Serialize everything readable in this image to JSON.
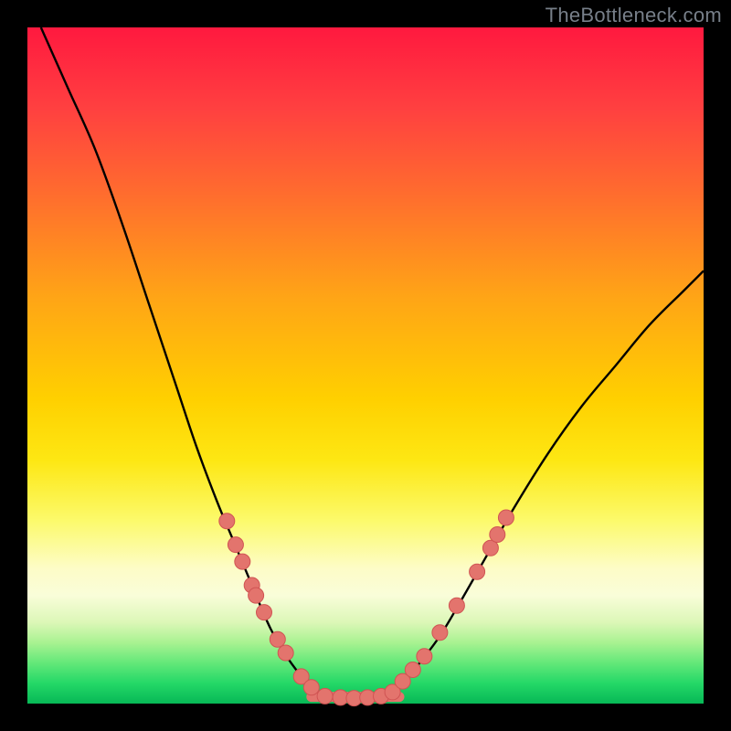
{
  "watermark": "TheBottleneck.com",
  "colors": {
    "curve_stroke": "#000000",
    "marker_fill": "#e3746d",
    "marker_stroke": "#d05453",
    "plateau_stroke": "#e3746d"
  },
  "chart_data": {
    "type": "line",
    "title": "",
    "xlabel": "",
    "ylabel": "",
    "xlim": [
      0,
      100
    ],
    "ylim": [
      0,
      100
    ],
    "curve": [
      {
        "x": 2,
        "y": 100
      },
      {
        "x": 6,
        "y": 91
      },
      {
        "x": 10,
        "y": 82
      },
      {
        "x": 14,
        "y": 71
      },
      {
        "x": 18,
        "y": 59
      },
      {
        "x": 22,
        "y": 47
      },
      {
        "x": 25,
        "y": 38
      },
      {
        "x": 28,
        "y": 30
      },
      {
        "x": 30.5,
        "y": 24
      },
      {
        "x": 33,
        "y": 18
      },
      {
        "x": 36,
        "y": 11
      },
      {
        "x": 39,
        "y": 6
      },
      {
        "x": 42,
        "y": 2.5
      },
      {
        "x": 44,
        "y": 1.2
      },
      {
        "x": 46,
        "y": 0.8
      },
      {
        "x": 50,
        "y": 0.8
      },
      {
        "x": 53,
        "y": 1.2
      },
      {
        "x": 55,
        "y": 2.5
      },
      {
        "x": 58,
        "y": 6
      },
      {
        "x": 61,
        "y": 10
      },
      {
        "x": 64,
        "y": 15
      },
      {
        "x": 68,
        "y": 22
      },
      {
        "x": 72,
        "y": 29
      },
      {
        "x": 77,
        "y": 37
      },
      {
        "x": 82,
        "y": 44
      },
      {
        "x": 87,
        "y": 50
      },
      {
        "x": 92,
        "y": 56
      },
      {
        "x": 97,
        "y": 61
      },
      {
        "x": 100,
        "y": 64
      }
    ],
    "plateau": {
      "x1": 42,
      "x2": 55,
      "y": 1.0
    },
    "markers_left": [
      {
        "x": 29.5,
        "y": 27
      },
      {
        "x": 30.8,
        "y": 23.5
      },
      {
        "x": 31.8,
        "y": 21
      },
      {
        "x": 33.2,
        "y": 17.5
      },
      {
        "x": 33.8,
        "y": 16
      },
      {
        "x": 35.0,
        "y": 13.5
      },
      {
        "x": 37.0,
        "y": 9.5
      },
      {
        "x": 38.2,
        "y": 7.5
      },
      {
        "x": 40.5,
        "y": 4
      },
      {
        "x": 42.0,
        "y": 2.4
      }
    ],
    "markers_plateau": [
      {
        "x": 44.0,
        "y": 1.1
      },
      {
        "x": 46.3,
        "y": 0.9
      },
      {
        "x": 48.3,
        "y": 0.8
      },
      {
        "x": 50.3,
        "y": 0.9
      },
      {
        "x": 52.3,
        "y": 1.1
      },
      {
        "x": 54.0,
        "y": 1.7
      }
    ],
    "markers_right": [
      {
        "x": 55.5,
        "y": 3.3
      },
      {
        "x": 57.0,
        "y": 5.0
      },
      {
        "x": 58.7,
        "y": 7.0
      },
      {
        "x": 61.0,
        "y": 10.5
      },
      {
        "x": 63.5,
        "y": 14.5
      },
      {
        "x": 66.5,
        "y": 19.5
      },
      {
        "x": 68.5,
        "y": 23
      },
      {
        "x": 69.5,
        "y": 25
      },
      {
        "x": 70.8,
        "y": 27.5
      }
    ]
  }
}
